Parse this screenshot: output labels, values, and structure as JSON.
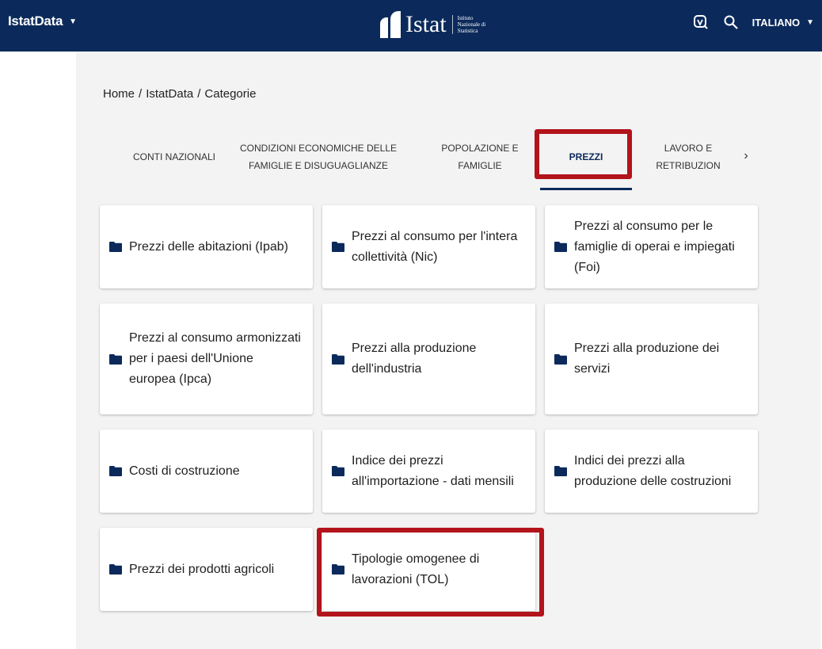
{
  "header": {
    "app_name": "IstatData",
    "brand_word": "Istat",
    "brand_sub": "Istituto Nazionale di Statistica",
    "language": "ITALIANO",
    "background_color": "#0b2a5b"
  },
  "breadcrumb": {
    "home": "Home",
    "section": "IstatData",
    "current": "Categorie",
    "separator": "/"
  },
  "tabs": [
    {
      "label": "CONTI NAZIONALI"
    },
    {
      "label": "CONDIZIONI ECONOMICHE DELLE FAMIGLIE E DISUGUAGLIANZE"
    },
    {
      "label": "POPOLAZIONE E FAMIGLIE"
    },
    {
      "label": "PREZZI",
      "active": true
    },
    {
      "label": "LAVORO E RETRIBUZION"
    }
  ],
  "categories": [
    {
      "label": "Prezzi delle abitazioni (Ipab)"
    },
    {
      "label": "Prezzi al consumo per l'intera collettività (Nic)"
    },
    {
      "label": "Prezzi al consumo per le famiglie di operai e impiegati (Foi)"
    },
    {
      "label": "Prezzi al consumo armonizzati per i paesi dell'Unione europea (Ipca)"
    },
    {
      "label": "Prezzi alla produzione dell'industria"
    },
    {
      "label": "Prezzi alla produzione dei servizi"
    },
    {
      "label": "Costi di costruzione"
    },
    {
      "label": "Indice dei prezzi all'importazione - dati mensili"
    },
    {
      "label": "Indici dei prezzi alla produzione delle costruzioni"
    },
    {
      "label": "Prezzi dei prodotti agricoli"
    },
    {
      "label": "Tipologie omogenee di lavorazioni (TOL)"
    }
  ],
  "icons": {
    "header_menu_caret": "caret-down-icon",
    "accessibility": "accessibility-icon",
    "search": "search-icon",
    "language_caret": "caret-down-icon",
    "tabs_next": "chevron-right-icon",
    "category": "folder-icon"
  },
  "colors": {
    "accent": "#0b2a5b",
    "highlight": "#b3131b",
    "panel_background": "#f3f3f3"
  }
}
